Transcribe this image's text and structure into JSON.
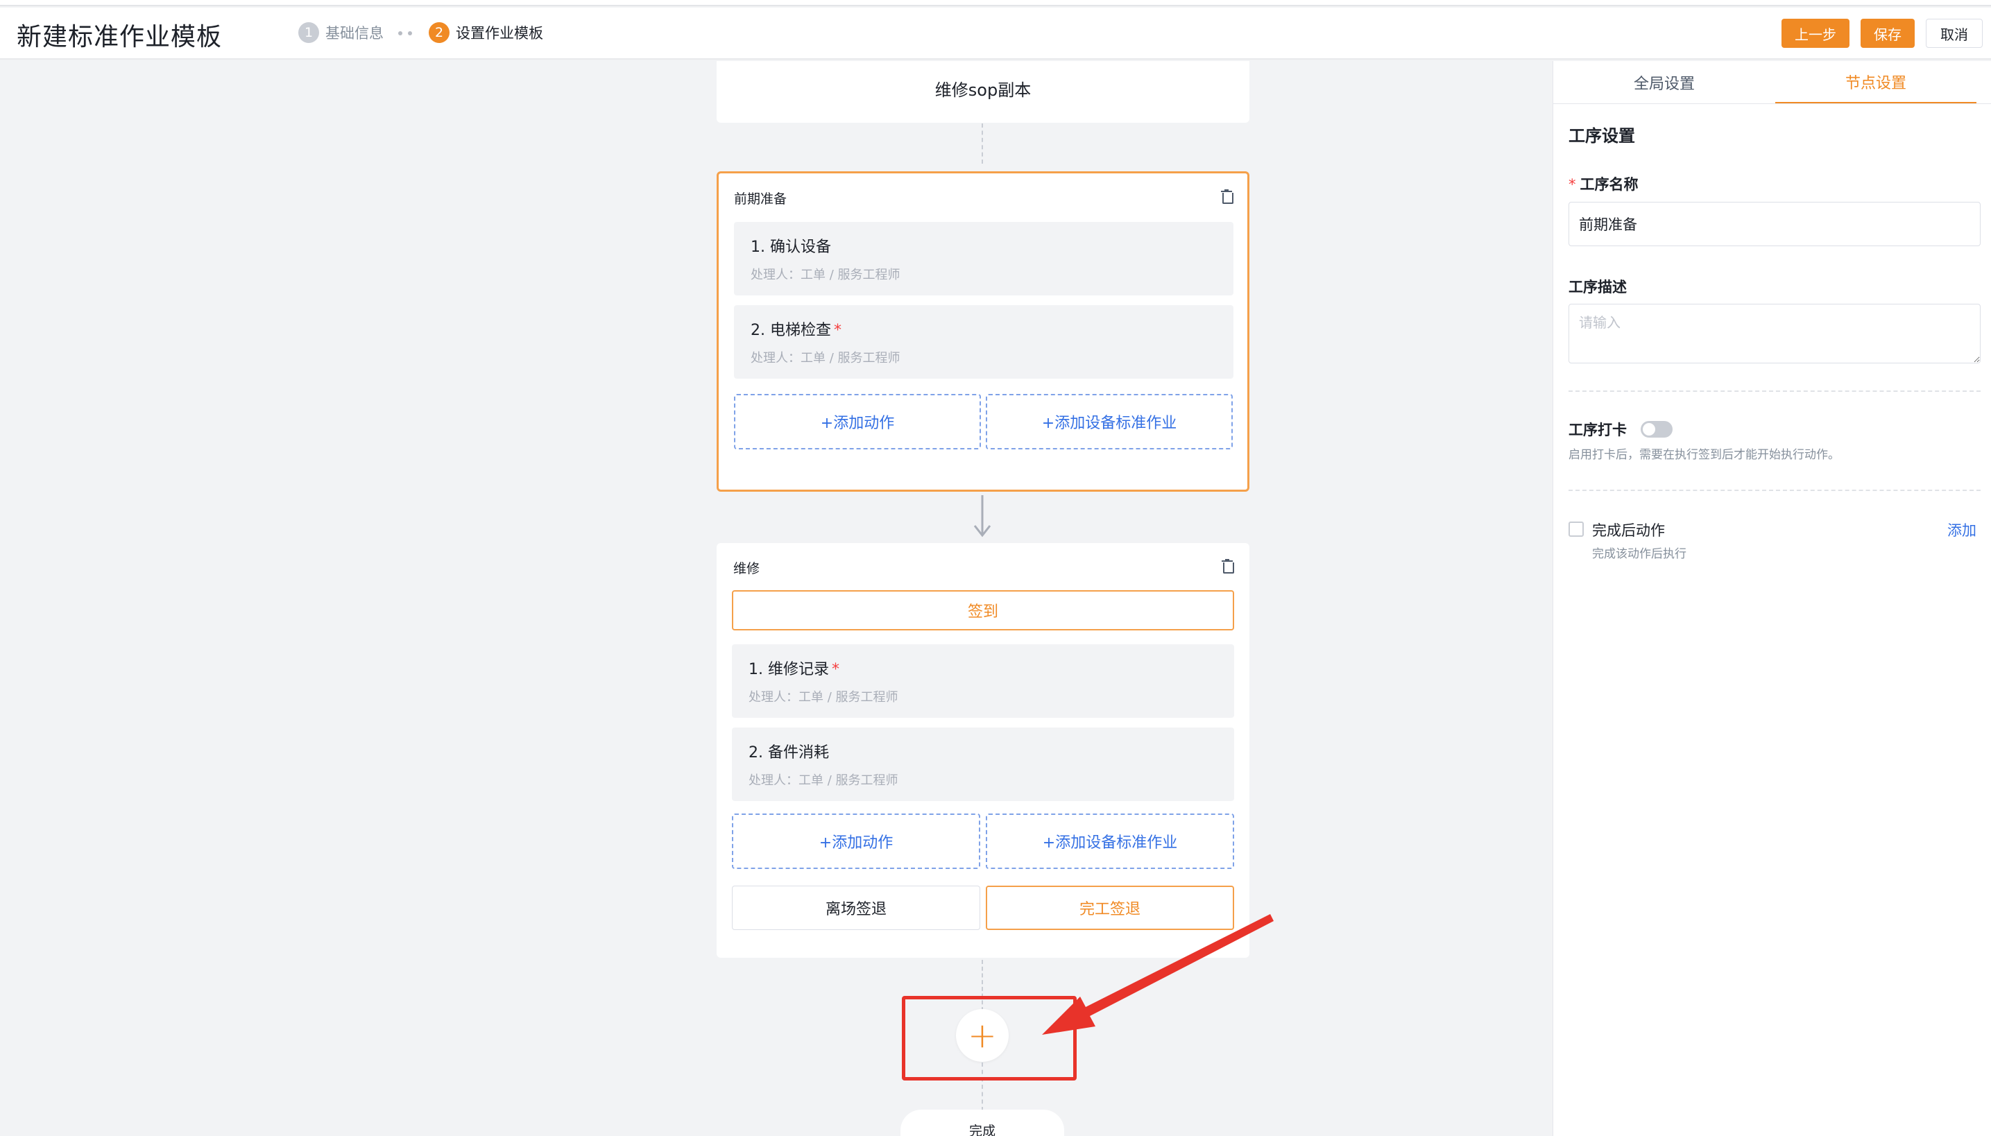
{
  "header": {
    "title": "新建标准作业模板",
    "steps": [
      {
        "num": "1",
        "label": "基础信息"
      },
      {
        "num": "2",
        "label": "设置作业模板"
      }
    ],
    "buttons": {
      "prev": "上一步",
      "save": "保存",
      "cancel": "取消"
    }
  },
  "flow": {
    "template_name": "维修sop副本",
    "stages": [
      {
        "title": "前期准备",
        "actions": [
          {
            "title": "1. 确认设备",
            "required": false,
            "handler": "处理人：工单 / 服务工程师"
          },
          {
            "title": "2. 电梯检查",
            "required": true,
            "handler": "处理人：工单 / 服务工程师"
          }
        ],
        "add_action": "+添加动作",
        "add_device_sop": "+添加设备标准作业"
      },
      {
        "title": "维修",
        "checkin": "签到",
        "actions": [
          {
            "title": "1. 维修记录",
            "required": true,
            "handler": "处理人：工单 / 服务工程师"
          },
          {
            "title": "2. 备件消耗",
            "required": false,
            "handler": "处理人：工单 / 服务工程师"
          }
        ],
        "add_action": "+添加动作",
        "add_device_sop": "+添加设备标准作业",
        "leave_checkout": "离场签退",
        "finish_checkout": "完工签退"
      }
    ],
    "add_stage_symbol": "+",
    "end_label": "完成"
  },
  "panel": {
    "tabs": [
      "全局设置",
      "节点设置"
    ],
    "active_tab": "节点设置",
    "section_title": "工序设置",
    "name_label": "工序名称",
    "name_required_mark": "*",
    "name_value": "前期准备",
    "desc_label": "工序描述",
    "desc_placeholder": "请输入",
    "checkin_label": "工序打卡",
    "checkin_enabled": false,
    "checkin_note": "启用打卡后，需要在执行签到后才能开始执行动作。",
    "after_action_label": "完成后动作",
    "after_action_note": "完成该动作后执行",
    "after_action_link": "添加"
  },
  "required_mark": "*",
  "colors": {
    "accent": "#f08a24",
    "link": "#3470e4",
    "danger": "#f53f3f",
    "annotation": "#e8332a"
  }
}
